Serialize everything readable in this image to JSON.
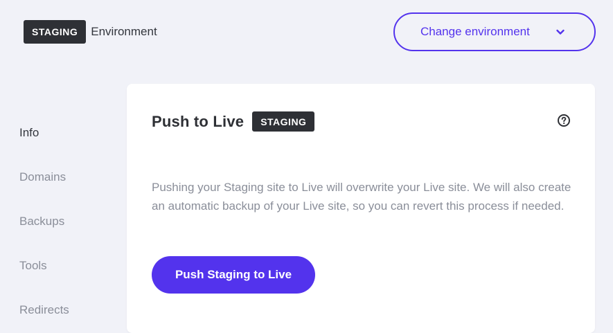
{
  "env_header": {
    "badge": "STAGING",
    "label": "Environment"
  },
  "change_env": {
    "label": "Change environment",
    "icon": "chevron-down-icon"
  },
  "sidebar": {
    "items": [
      {
        "label": "Info",
        "active": true
      },
      {
        "label": "Domains",
        "active": false
      },
      {
        "label": "Backups",
        "active": false
      },
      {
        "label": "Tools",
        "active": false
      },
      {
        "label": "Redirects",
        "active": false
      }
    ]
  },
  "card": {
    "title": "Push to Live",
    "badge": "STAGING",
    "help_icon": "question-circle-icon",
    "description": "Pushing your Staging site to Live will overwrite your Live site. We will also create an automatic backup of your Live site, so you can revert this process if needed.",
    "button_label": "Push Staging to Live"
  },
  "colors": {
    "background": "#f1f2f8",
    "accent": "#5333ed",
    "badge_bg": "#2e3035",
    "text_primary": "#33363d",
    "text_muted": "#8a8e99"
  }
}
